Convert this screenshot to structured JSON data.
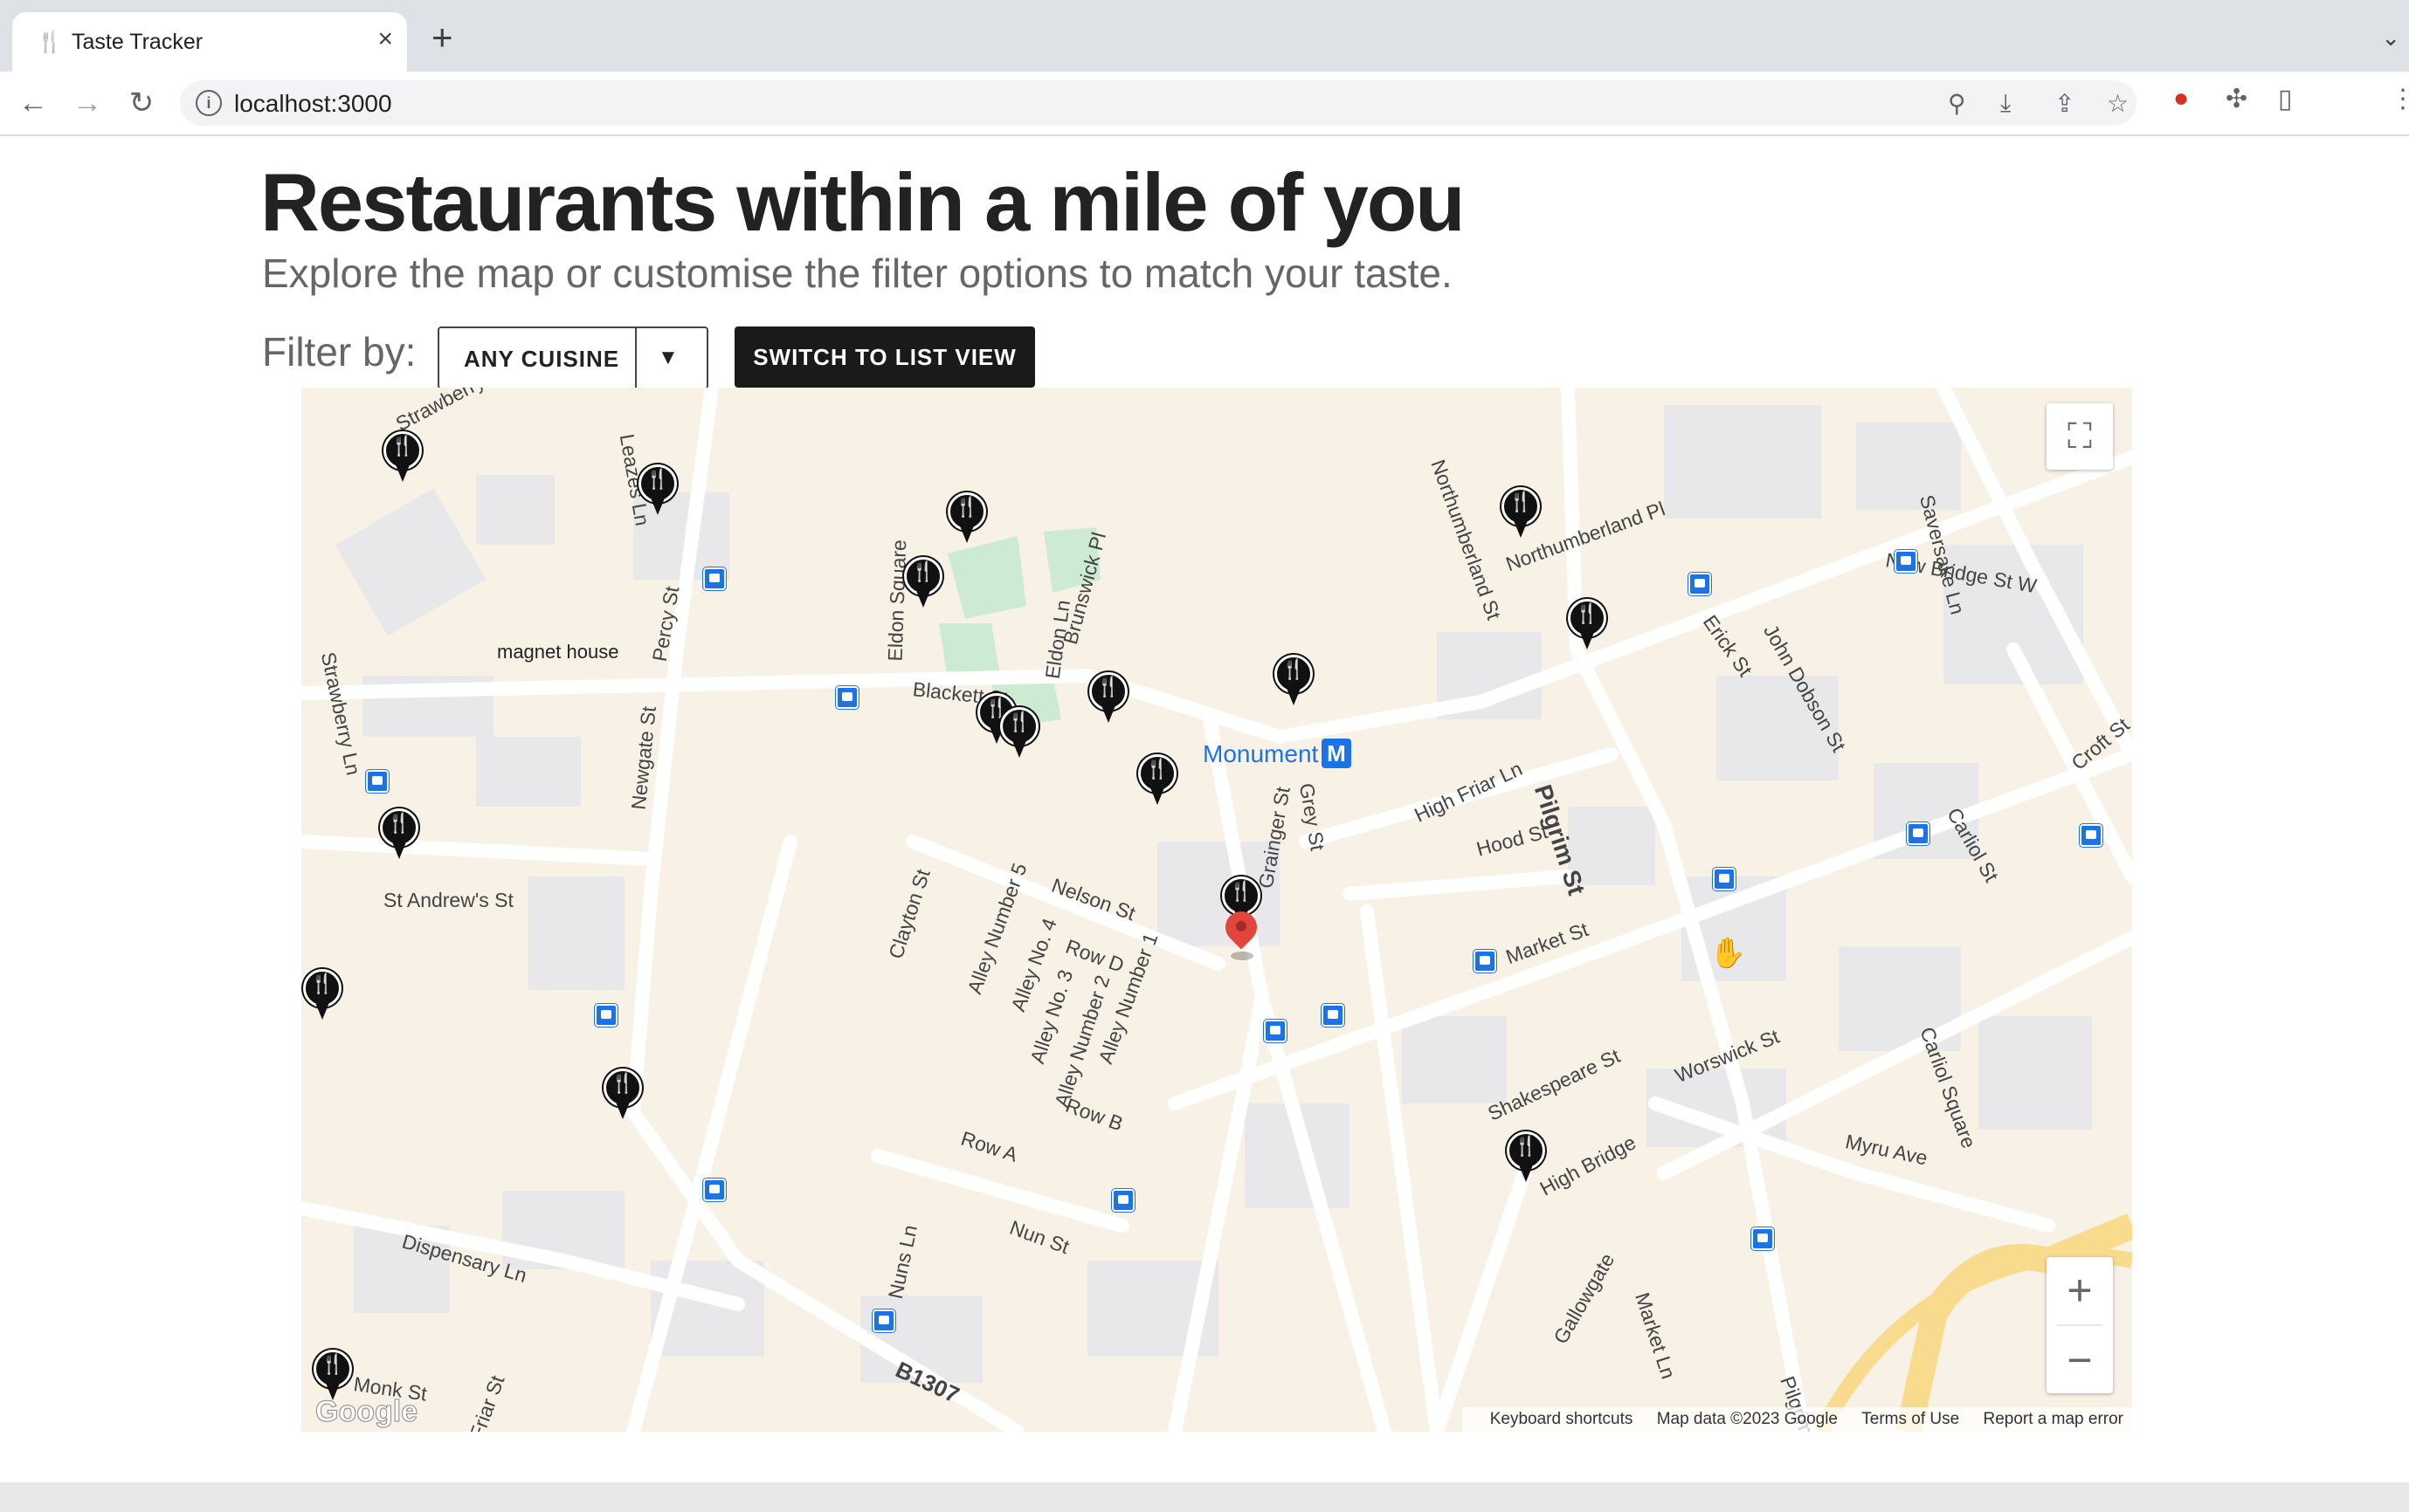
{
  "browser": {
    "tab_title": "Taste Tracker",
    "tab_icon": "fork-knife-icon",
    "url": "localhost:3000"
  },
  "page": {
    "title": "Restaurants within a mile of you",
    "subtitle": "Explore the map or customise the filter options to match your taste.",
    "filter_label": "Filter by:",
    "cuisine_select_value": "ANY CUISINE",
    "switch_button": "SWITCH TO LIST VIEW"
  },
  "map": {
    "streets": [
      {
        "label": "Strawberry Pl"
      },
      {
        "label": "Leazes Ln"
      },
      {
        "label": "Percy St"
      },
      {
        "label": "Strawberry Ln"
      },
      {
        "label": "Newgate St"
      },
      {
        "label": "St Andrew's St"
      },
      {
        "label": "Eldon Square"
      },
      {
        "label": "Eldon Ln"
      },
      {
        "label": "Blackett St"
      },
      {
        "label": "Brunswick Pl"
      },
      {
        "label": "Northumberland St"
      },
      {
        "label": "Northumberland Pl"
      },
      {
        "label": "Erick St"
      },
      {
        "label": "John Dobson St"
      },
      {
        "label": "New Bridge St W"
      },
      {
        "label": "Saversake Ln"
      },
      {
        "label": "High Friar Ln"
      },
      {
        "label": "Grainger St"
      },
      {
        "label": "Grey St"
      },
      {
        "label": "Pilgrim St"
      },
      {
        "label": "Hood St"
      },
      {
        "label": "Market St"
      },
      {
        "label": "Carliol St"
      },
      {
        "label": "Croft St"
      },
      {
        "label": "Nelson St"
      },
      {
        "label": "Clayton St"
      },
      {
        "label": "Alley Number 5"
      },
      {
        "label": "Alley No. 4"
      },
      {
        "label": "Row D"
      },
      {
        "label": "Alley No. 3"
      },
      {
        "label": "Alley Number 2"
      },
      {
        "label": "Alley Number 1"
      },
      {
        "label": "Row B"
      },
      {
        "label": "Row A"
      },
      {
        "label": "Shakespeare St"
      },
      {
        "label": "Worswick St"
      },
      {
        "label": "Carliol Square"
      },
      {
        "label": "Myru Ave"
      },
      {
        "label": "High Bridge"
      },
      {
        "label": "Nun St"
      },
      {
        "label": "Nuns Ln"
      },
      {
        "label": "Dispensary Ln"
      },
      {
        "label": "B1307"
      },
      {
        "label": "Monk St"
      },
      {
        "label": "Friar St"
      },
      {
        "label": "Market Ln"
      },
      {
        "label": "Pilgrim"
      },
      {
        "label": "Gallowgate"
      }
    ],
    "poi": "magnet house",
    "metro_station": "Monument",
    "metro_icon": "M",
    "footer": {
      "shortcuts": "Keyboard shortcuts",
      "data": "Map data ©2023 Google",
      "terms": "Terms of Use",
      "report": "Report a map error"
    },
    "logo": "Google",
    "zoom_in": "+",
    "zoom_out": "−",
    "fullscreen_icon": "fullscreen-icon",
    "marker_icon": "fork-knife-icon",
    "user_location_icon": "location-pin-icon"
  }
}
